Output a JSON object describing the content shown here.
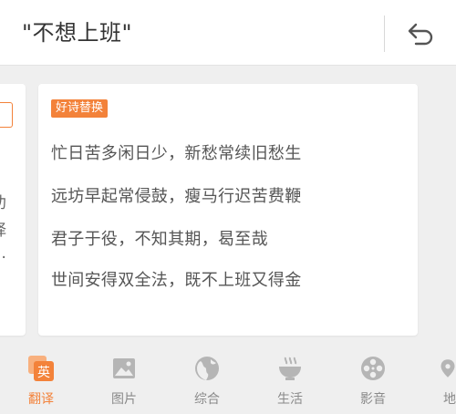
{
  "search": {
    "query": "\"不想上班\""
  },
  "left_card": {
    "lines": [
      "劝",
      "择",
      "…"
    ]
  },
  "card": {
    "tag": "好诗替换",
    "lines": [
      "忙日苦多闲日少，新愁常续旧愁生",
      "远坊早起常侵鼓，瘦马行迟苦费鞭",
      "君子于役，不知其期，曷至哉",
      "世间安得双全法，既不上班又得金"
    ]
  },
  "nav": {
    "items": [
      {
        "label": "翻译",
        "icon": "translate-icon",
        "glyph": "英",
        "active": true
      },
      {
        "label": "图片",
        "icon": "image-icon"
      },
      {
        "label": "综合",
        "icon": "globe-icon"
      },
      {
        "label": "生活",
        "icon": "bowl-icon"
      },
      {
        "label": "影音",
        "icon": "film-reel-icon"
      },
      {
        "label": "地",
        "icon": "map-pin-icon"
      }
    ]
  },
  "colors": {
    "accent": "#f3823a",
    "icon_gray": "#b5b5b5"
  }
}
